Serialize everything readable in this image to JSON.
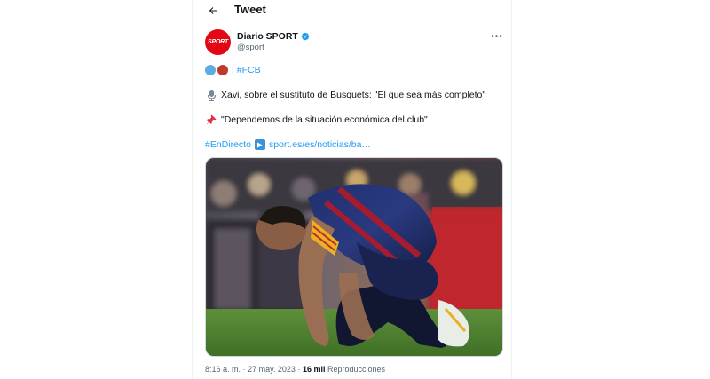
{
  "header": {
    "title": "Tweet"
  },
  "author": {
    "name": "Diario SPORT",
    "handle": "@sport",
    "avatar_text": "SPORT",
    "verified": true,
    "avatar_color": "#e30613",
    "verified_color": "#1d9bf0"
  },
  "tweet": {
    "hashtag_fcb": "#FCB",
    "separator": "|",
    "line_xavi": "Xavi, sobre el sustituto de Busquets: \"El que sea más completo\"",
    "line_quote": "\"Dependemos de la situación económica del club\"",
    "hashtag_directo": "#EnDirecto",
    "link_text": "sport.es/es/noticias/ba…",
    "dot_colors": [
      "#5dade2",
      "#c0392b"
    ],
    "link_color": "#1d9bf0"
  },
  "meta": {
    "time": "8:16 a. m.",
    "dot": "·",
    "date": "27 may. 2023",
    "views_count": "16 mil",
    "views_label": "Reproducciones"
  }
}
